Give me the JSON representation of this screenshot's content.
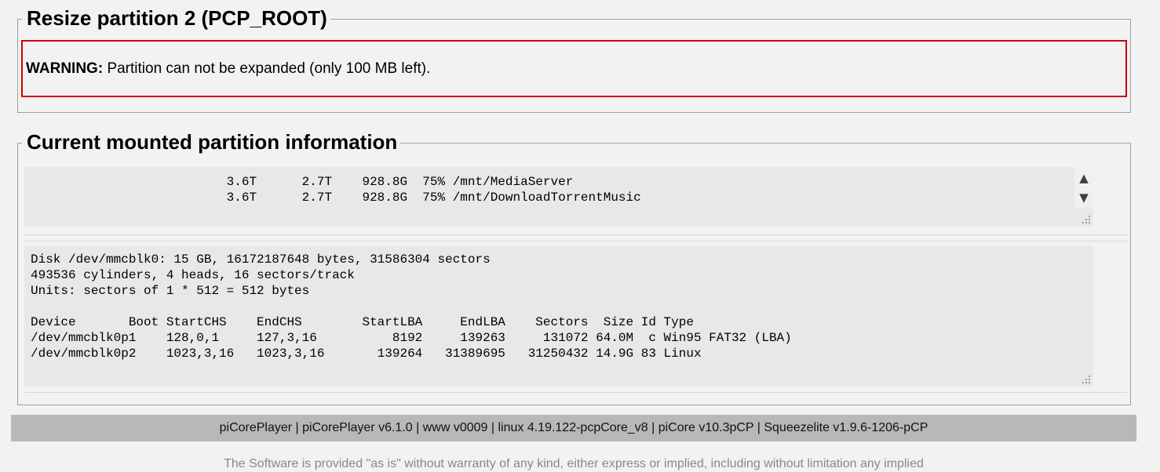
{
  "resize_section": {
    "title": "Resize partition 2 (PCP_ROOT)",
    "warning_label": "WARNING:",
    "warning_message": "Partition can not be expanded (only 100 MB left)."
  },
  "current_section": {
    "title": "Current mounted partition information",
    "mounts_text": "                          3.6T      2.7T    928.8G  75% /mnt/MediaServer\n                          3.6T      2.7T    928.8G  75% /mnt/DownloadTorrentMusic",
    "fdisk_text": "Disk /dev/mmcblk0: 15 GB, 16172187648 bytes, 31586304 sectors\n493536 cylinders, 4 heads, 16 sectors/track\nUnits: sectors of 1 * 512 = 512 bytes\n\nDevice       Boot StartCHS    EndCHS        StartLBA     EndLBA    Sectors  Size Id Type\n/dev/mmcblk0p1    128,0,1     127,3,16          8192     139263     131072 64.0M  c Win95 FAT32 (LBA)\n/dev/mmcblk0p2    1023,3,16   1023,3,16       139264   31389695   31250432 14.9G 83 Linux"
  },
  "icons": {
    "scroll_up": "▲",
    "scroll_down": "▼"
  },
  "footer": {
    "version_text": "piCorePlayer | piCorePlayer v6.1.0 | www v0009 | linux 4.19.122-pcpCore_v8 | piCore v10.3pCP | Squeezelite v1.9.6-1206-pCP",
    "disclaimer": "The Software is provided \"as is\" without warranty of any kind, either express or implied, including without limitation any implied"
  }
}
